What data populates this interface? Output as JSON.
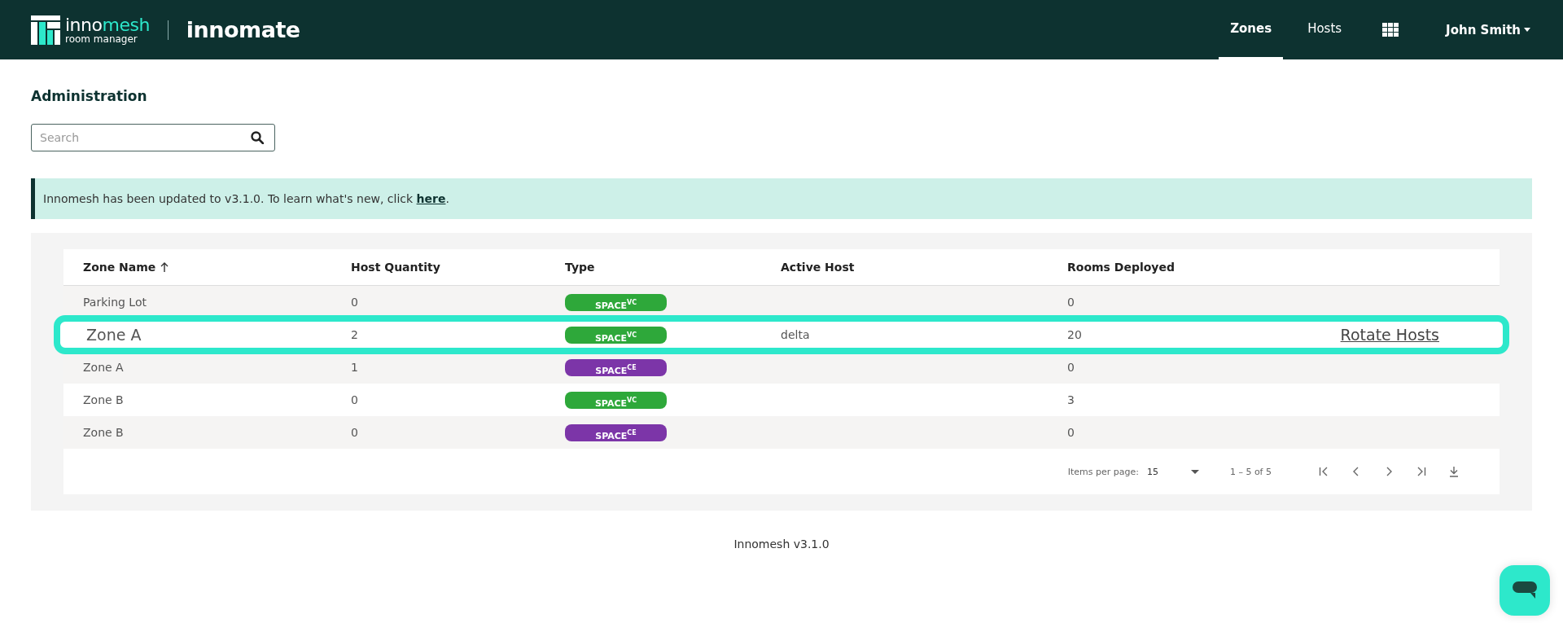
{
  "header": {
    "logo": {
      "brand_start": "inno",
      "brand_end": "mesh",
      "subtitle": "room manager"
    },
    "product": "innomate",
    "nav": [
      {
        "label": "Zones",
        "selected": true
      },
      {
        "label": "Hosts",
        "selected": false
      }
    ],
    "user": "John Smith"
  },
  "page_title": "Administration",
  "search": {
    "placeholder": "Search"
  },
  "banner": {
    "text": "Innomesh has been updated to v3.1.0. To learn what's new, click ",
    "link": "here",
    "end": "."
  },
  "table": {
    "columns": [
      {
        "label": "Zone Name",
        "sorted": true
      },
      {
        "label": "Host Quantity",
        "sorted": false
      },
      {
        "label": "Type",
        "sorted": false
      },
      {
        "label": "Active Host",
        "sorted": false
      },
      {
        "label": "Rooms Deployed",
        "sorted": false
      }
    ],
    "rows": [
      {
        "zone": "Parking Lot",
        "hosts": "0",
        "type": {
          "label": "SPACE$^{VC}$",
          "color": "#2ea83a"
        },
        "active_host": "",
        "rooms": "0",
        "highlighted": false
      },
      {
        "zone": "Zone A",
        "hosts": "2",
        "type": {
          "label": "SPACE$^{VC}$",
          "color": "#2ea83a"
        },
        "active_host": "delta",
        "rooms": "20",
        "action": "Rotate Hosts",
        "highlighted": true
      },
      {
        "zone": "Zone A",
        "hosts": "1",
        "type": {
          "label": "SPACE$^{CE}$",
          "color": "#7c35a8"
        },
        "active_host": "",
        "rooms": "0",
        "highlighted": false
      },
      {
        "zone": "Zone B",
        "hosts": "0",
        "type": {
          "label": "SPACE$^{VC}$",
          "color": "#2ea83a"
        },
        "active_host": "",
        "rooms": "3",
        "highlighted": false
      },
      {
        "zone": "Zone B",
        "hosts": "0",
        "type": {
          "label": "SPACE$^{CE}$",
          "color": "#7c35a8"
        },
        "active_host": "",
        "rooms": "0",
        "highlighted": false
      }
    ]
  },
  "paginator": {
    "items_label": "Items per page:",
    "page_size": "15",
    "range": "1 – 5 of 5"
  },
  "footer": "Innomesh v3.1.0"
}
